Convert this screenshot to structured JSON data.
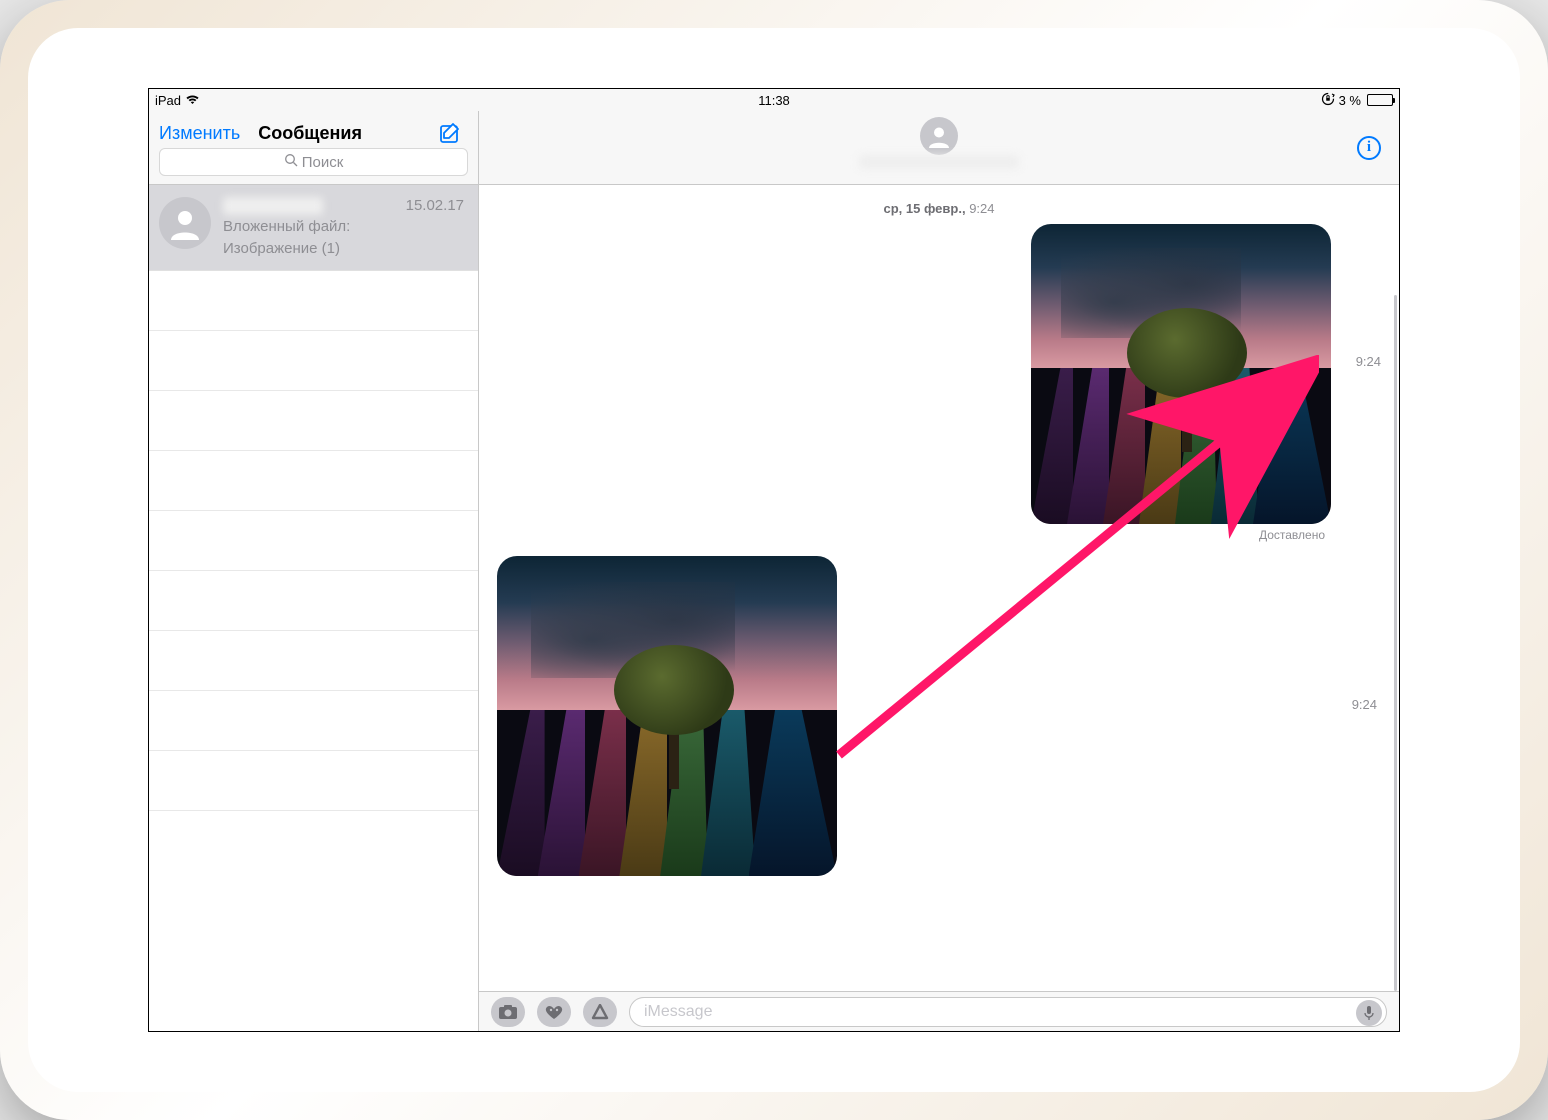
{
  "statusbar": {
    "device": "iPad",
    "time": "11:38",
    "battery_percent": "3 %"
  },
  "sidebar": {
    "edit": "Изменить",
    "title": "Сообщения",
    "search_placeholder": "Поиск",
    "conversations": [
      {
        "date": "15.02.17",
        "preview_line1": "Вложенный файл:",
        "preview_line2": "Изображение (1)"
      }
    ]
  },
  "pane": {
    "date_header_day": "ср, 15 февр.,",
    "date_header_time": "9:24",
    "messages": [
      {
        "side": "sent",
        "time": "9:24",
        "status": "Доставлено"
      },
      {
        "side": "received",
        "time": "9:24"
      }
    ],
    "compose_placeholder": "iMessage"
  }
}
